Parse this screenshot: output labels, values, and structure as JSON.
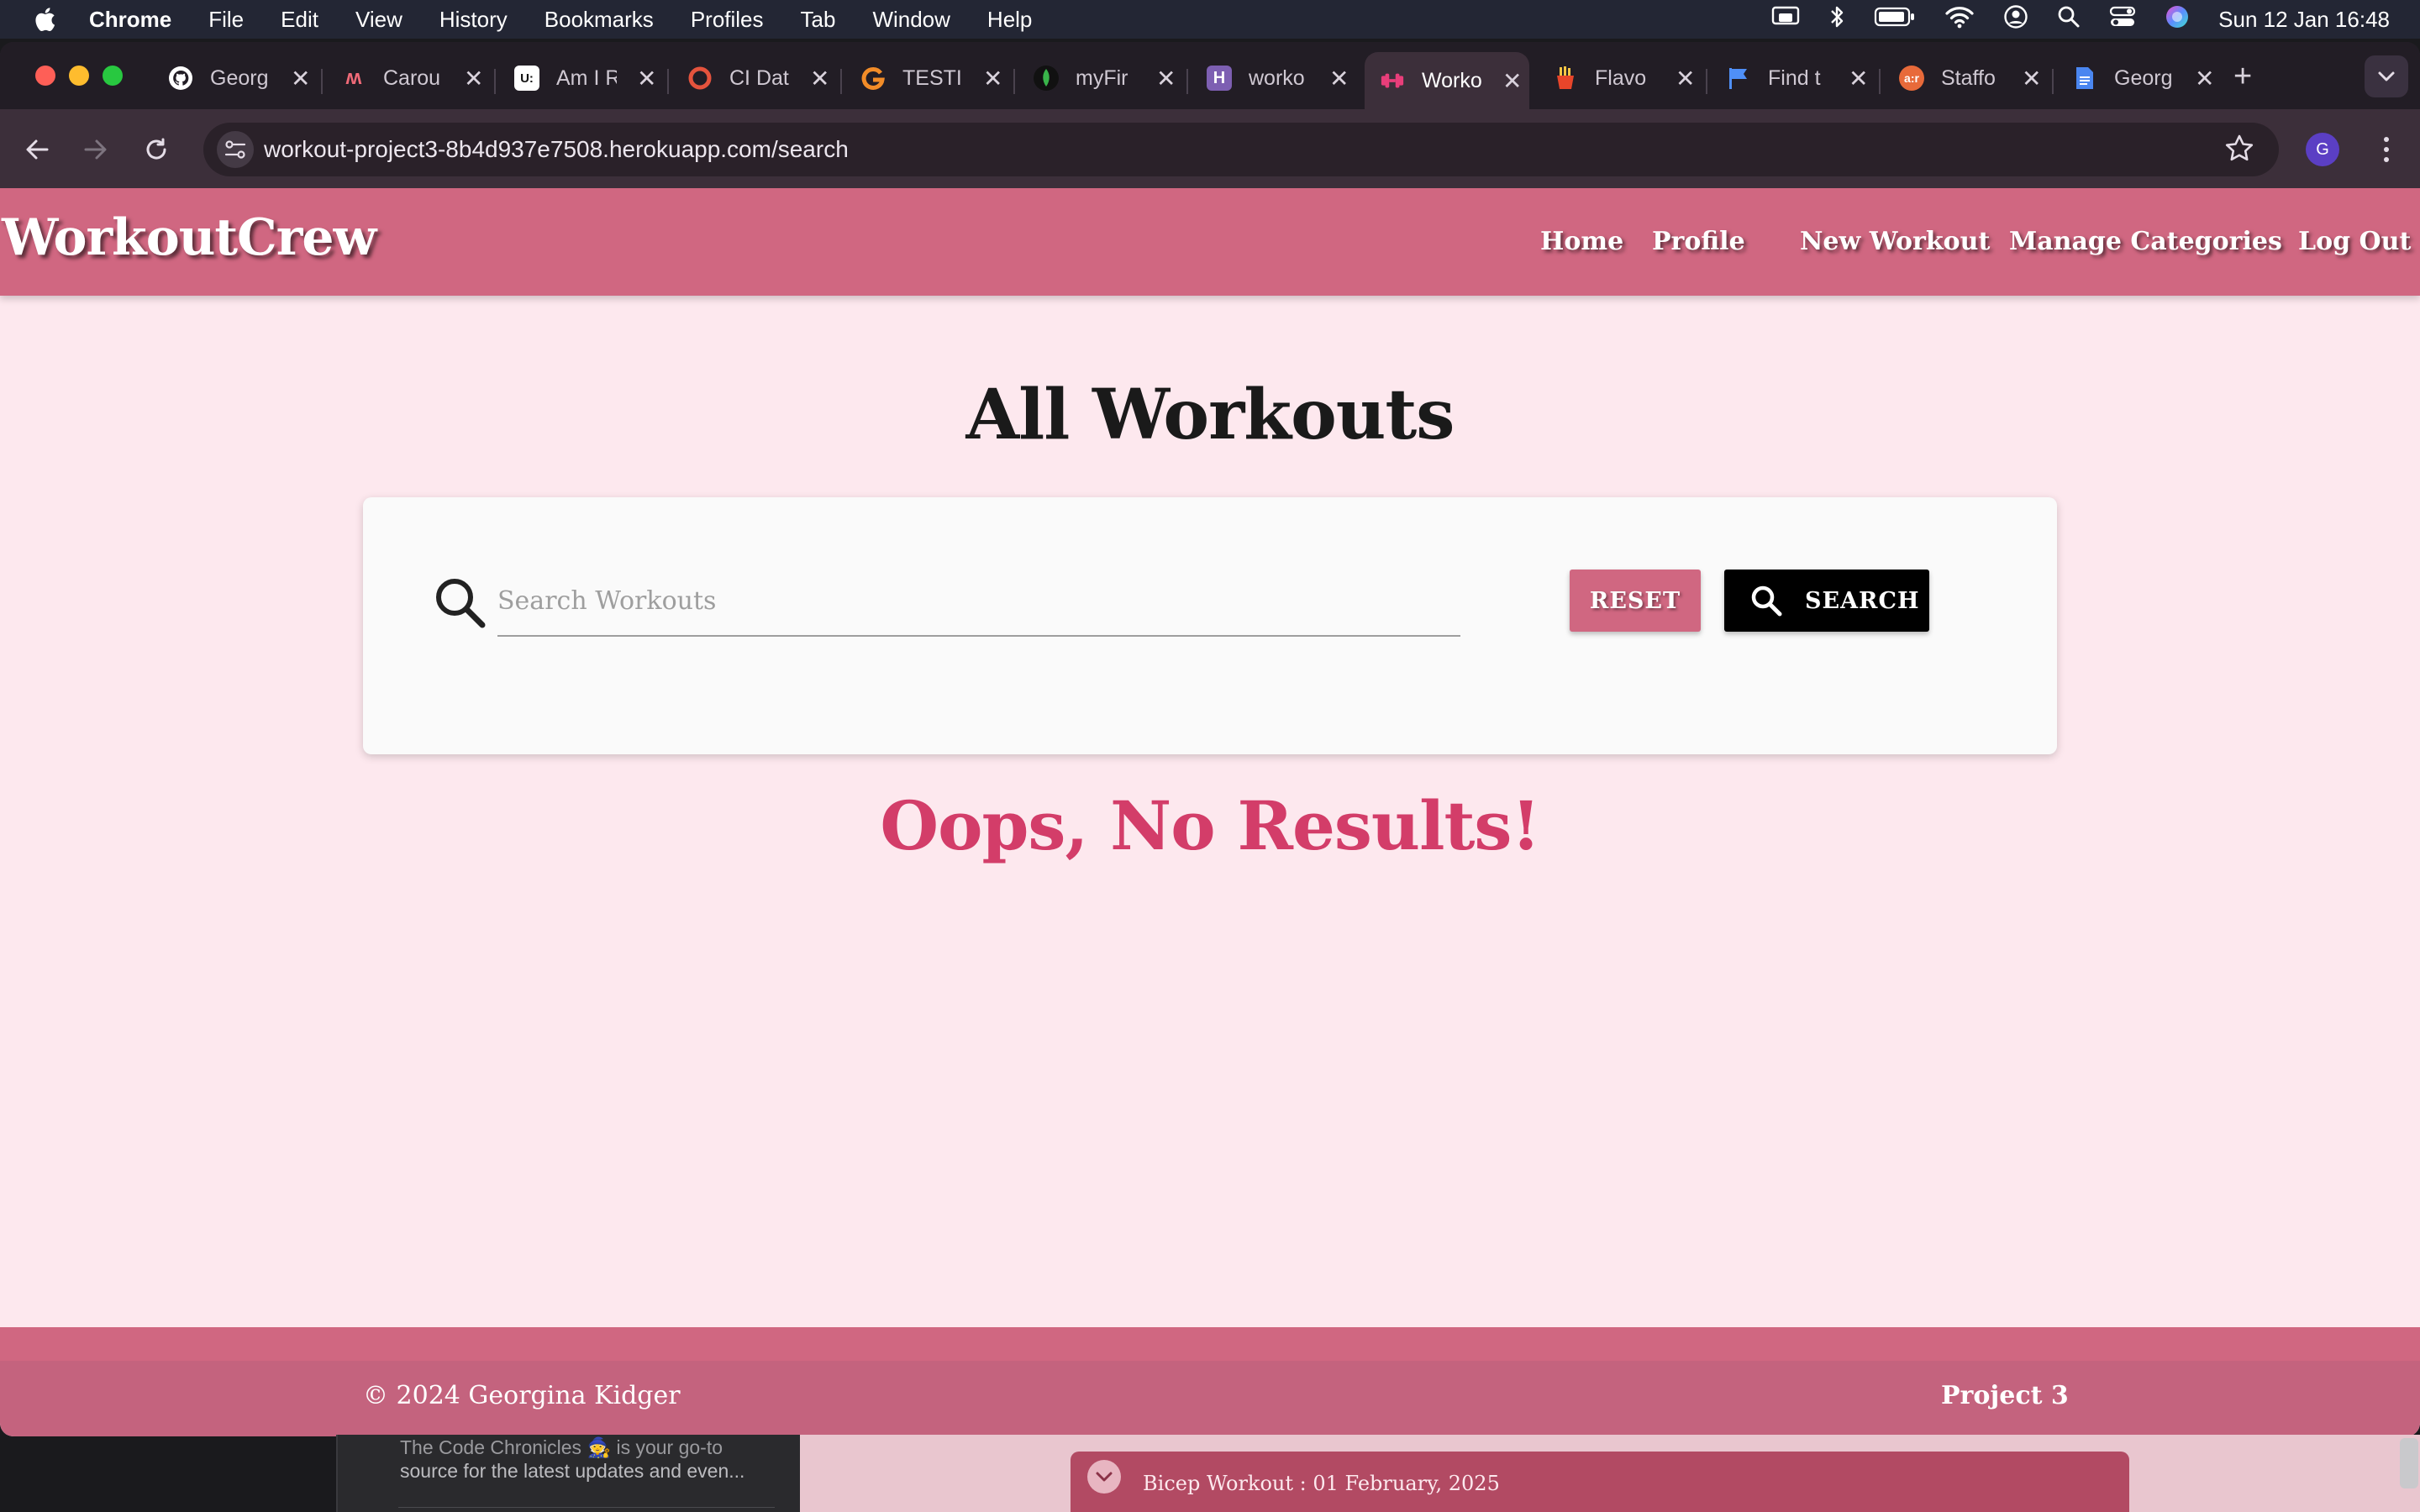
{
  "menubar": {
    "app_name": "Chrome",
    "items": [
      "File",
      "Edit",
      "View",
      "History",
      "Bookmarks",
      "Profiles",
      "Tab",
      "Window",
      "Help"
    ],
    "clock": "Sun 12 Jan  16:48"
  },
  "tabs": [
    {
      "title": "Georg",
      "icon": "github-icon",
      "color": "#ffffff"
    },
    {
      "title": "Carou",
      "icon": "m-logo-icon",
      "color": "#f06a78"
    },
    {
      "title": "Am I R",
      "icon": "ui-logo-icon",
      "color": "#111111"
    },
    {
      "title": "CI Dat",
      "icon": "ring-logo-icon",
      "color": "#e5533d"
    },
    {
      "title": "TESTI",
      "icon": "g-logo-icon",
      "color": "#f28c28"
    },
    {
      "title": "myFir",
      "icon": "leaf-icon",
      "color": "#39b54a"
    },
    {
      "title": "worko",
      "icon": "heroku-icon",
      "color": "#7d5fb2"
    },
    {
      "title": "Worko",
      "icon": "dumbbell-icon",
      "color": "#e83e7a",
      "active": true
    },
    {
      "title": "Flavo",
      "icon": "fries-icon",
      "color": "#e8a12a"
    },
    {
      "title": "Find t",
      "icon": "flag-icon",
      "color": "#4f8ff7"
    },
    {
      "title": "Staffo",
      "icon": "ar-logo-icon",
      "color": "#e86a3a"
    },
    {
      "title": "Georg",
      "icon": "docs-icon",
      "color": "#4a86f0"
    }
  ],
  "browser": {
    "url": "workout-project3-8b4d937e7508.herokuapp.com/search",
    "profile_initial": "G"
  },
  "site": {
    "brand": "WorkoutCrew",
    "nav": [
      "Home",
      "Profile",
      "New Workout",
      "Manage Categories",
      "Log Out"
    ],
    "page_title": "All Workouts",
    "search": {
      "placeholder": "Search Workouts",
      "value": "",
      "reset_label": "RESET",
      "search_label": "SEARCH"
    },
    "no_results": "Oops, No Results!",
    "footer": {
      "copyright": "© 2024 Georgina Kidger",
      "project": "Project 3"
    },
    "colors": {
      "primary": "#d06781",
      "background": "#fde8ee",
      "alert": "#d33d69"
    }
  },
  "background_windows": {
    "snippet_line1": "The Code Chronicles 🧙 is your go-to",
    "snippet_line2": "source for the latest updates and even...",
    "toast": "Bicep Workout : 01 February, 2025"
  }
}
